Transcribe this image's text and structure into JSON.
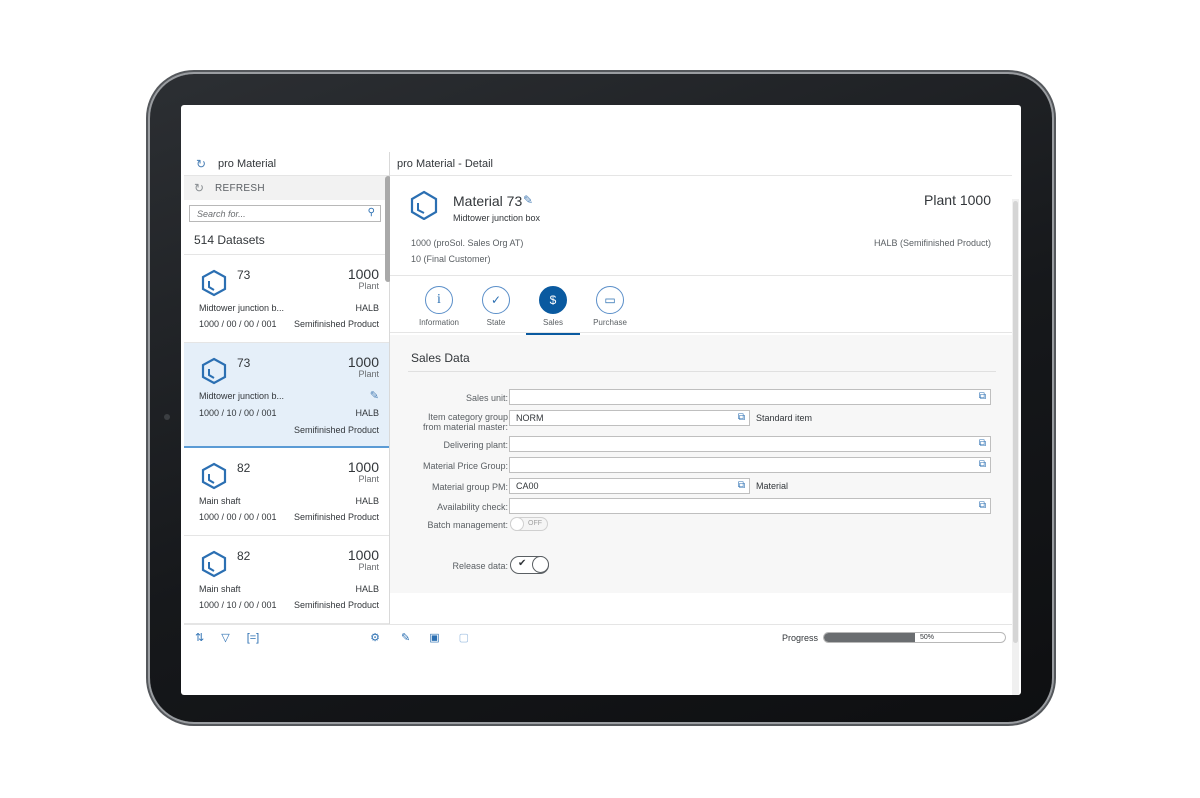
{
  "master": {
    "header_title": "pro Material",
    "refresh_label": "REFRESH",
    "search_placeholder": "Search for...",
    "dataset_count": "514 Datasets",
    "items": [
      {
        "num": "73",
        "plant_num": "1000",
        "plant_lbl": "Plant",
        "desc": "Midtower junction b...",
        "type": "HALB",
        "code": "1000 / 00 / 00 / 001",
        "type_desc": "Semifinished Product",
        "selected": false
      },
      {
        "num": "73",
        "plant_num": "1000",
        "plant_lbl": "Plant",
        "desc": "Midtower junction b...",
        "type": "HALB",
        "code": "1000 / 10 / 00 / 001",
        "type_desc": "Semifinished Product",
        "selected": true
      },
      {
        "num": "82",
        "plant_num": "1000",
        "plant_lbl": "Plant",
        "desc": "Main shaft",
        "type": "HALB",
        "code": "1000 / 00 / 00 / 001",
        "type_desc": "Semifinished Product",
        "selected": false
      },
      {
        "num": "82",
        "plant_num": "1000",
        "plant_lbl": "Plant",
        "desc": "Main shaft",
        "type": "HALB",
        "code": "1000 / 10 / 00 / 001",
        "type_desc": "Semifinished Product",
        "selected": false
      }
    ],
    "footer_icons": [
      "sort-icon",
      "filter-icon",
      "group-icon",
      "settings-icon"
    ]
  },
  "detail": {
    "title": "pro Material - Detail",
    "object": {
      "title": "Material 73",
      "subtitle": "Midtower junction box",
      "plant": "Plant 1000",
      "attr1": "1000 (proSol. Sales Org AT)",
      "attr2": "10 (Final Customer)",
      "type": "HALB (Semifinished Product)"
    },
    "tabs": [
      {
        "label": "Information",
        "icon": "info-icon",
        "glyph": "i",
        "active": false
      },
      {
        "label": "State",
        "icon": "check-circle-icon",
        "glyph": "✓",
        "active": false
      },
      {
        "label": "Sales",
        "icon": "sales-icon",
        "glyph": "$",
        "active": true
      },
      {
        "label": "Purchase",
        "icon": "wallet-icon",
        "glyph": "▭",
        "active": false
      }
    ],
    "section_title": "Sales Data",
    "fields": {
      "sales_unit": {
        "label": "Sales unit:",
        "value": ""
      },
      "item_cat": {
        "label1": "Item category group",
        "label2": "from material master:",
        "value": "NORM",
        "aside": "Standard item"
      },
      "delivering_plant": {
        "label": "Delivering plant:",
        "value": ""
      },
      "price_group": {
        "label": "Material Price Group:",
        "value": ""
      },
      "material_group": {
        "label": "Material group PM:",
        "value": "CA00",
        "aside": "Material"
      },
      "availability": {
        "label": "Availability check:",
        "value": ""
      },
      "batch": {
        "label": "Batch management:",
        "state": "OFF"
      },
      "release": {
        "label": "Release data:",
        "state": "ON"
      }
    },
    "progress": {
      "label": "Progress",
      "value": 50,
      "text": "50%"
    }
  }
}
